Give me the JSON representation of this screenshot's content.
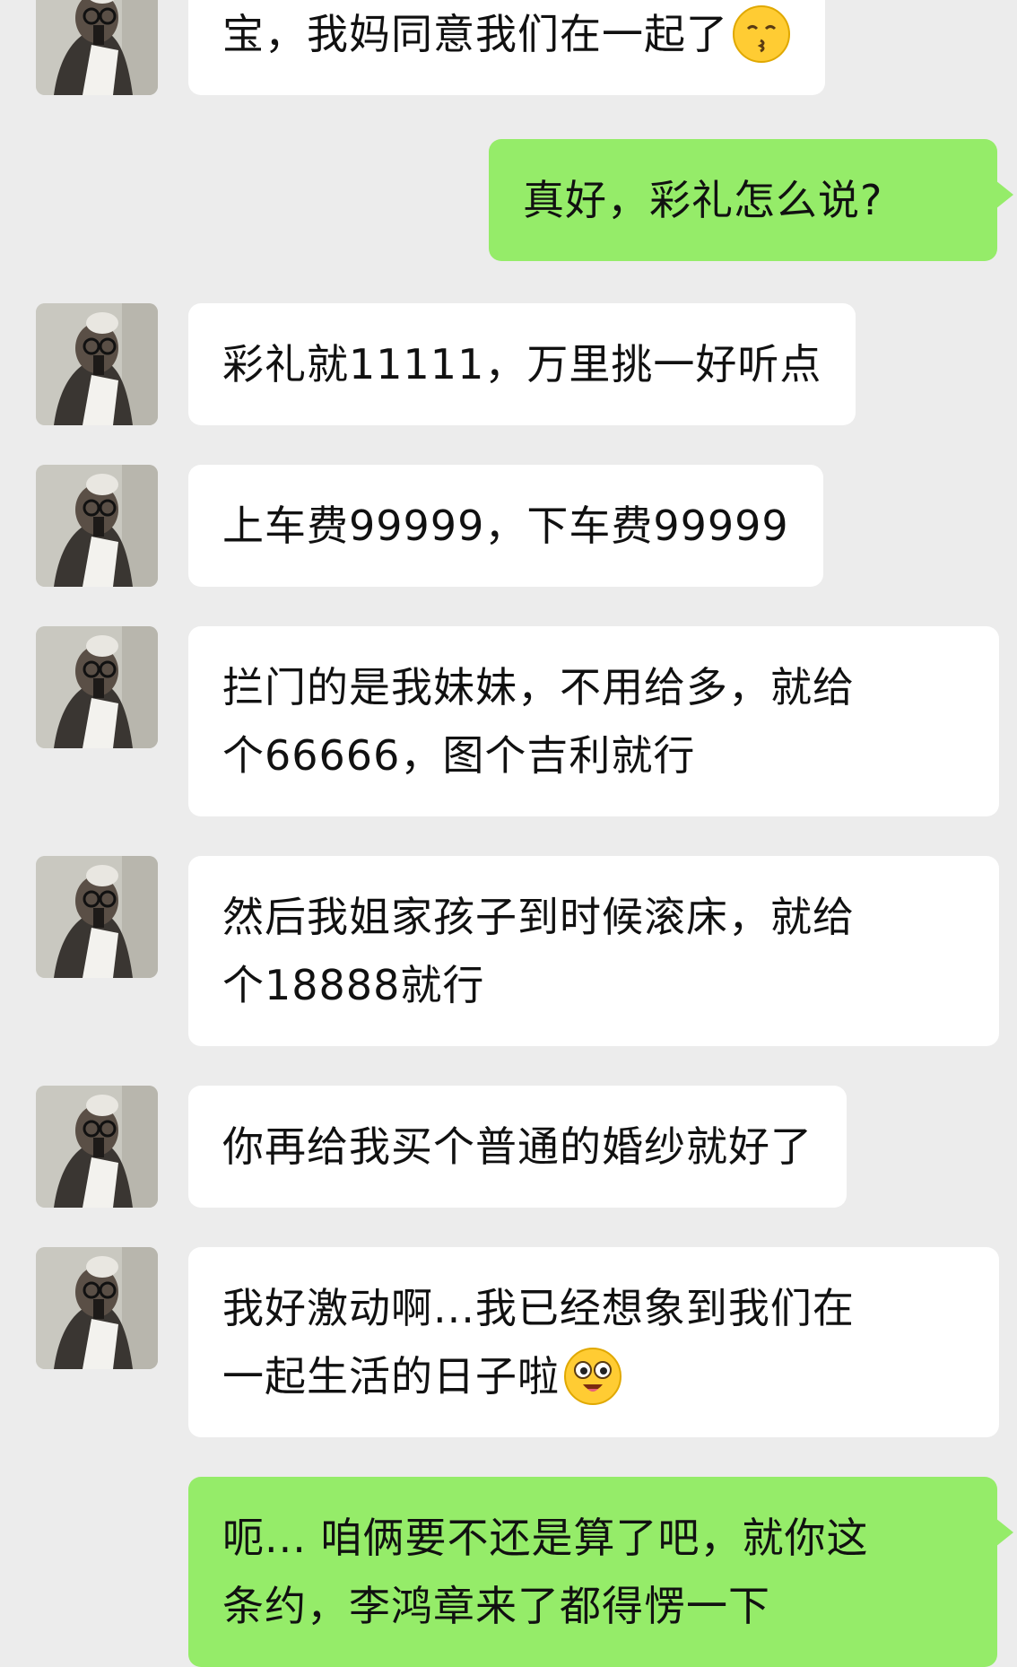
{
  "messages": [
    {
      "side": "in",
      "lines": [
        "宝，我妈同意我们在一起了"
      ],
      "emoji": "kissing-face-icon"
    },
    {
      "side": "out",
      "lines": [
        "真好，彩礼怎么说?"
      ]
    },
    {
      "side": "in",
      "lines": [
        "彩礼就11111，万里挑一好听点"
      ]
    },
    {
      "side": "in",
      "lines": [
        "上车费99999，下车费99999"
      ]
    },
    {
      "side": "in",
      "lines": [
        "拦门的是我妹妹，不用给多，就给",
        "个66666，图个吉利就行"
      ]
    },
    {
      "side": "in",
      "lines": [
        "然后我姐家孩子到时候滚床，就给",
        "个18888就行"
      ]
    },
    {
      "side": "in",
      "lines": [
        "你再给我买个普通的婚纱就好了"
      ]
    },
    {
      "side": "in",
      "lines": [
        "我好激动啊...我已经想象到我们在",
        "一起生活的日子啦"
      ],
      "emoji": "starstruck-face-icon"
    },
    {
      "side": "out",
      "lines": [
        "呃... 咱俩要不还是算了吧，就你这",
        "条约，李鸿章来了都得愣一下"
      ]
    }
  ],
  "colors": {
    "background": "#ececec",
    "incoming_bubble": "#ffffff",
    "outgoing_bubble": "#95ec69",
    "text": "#111111"
  }
}
